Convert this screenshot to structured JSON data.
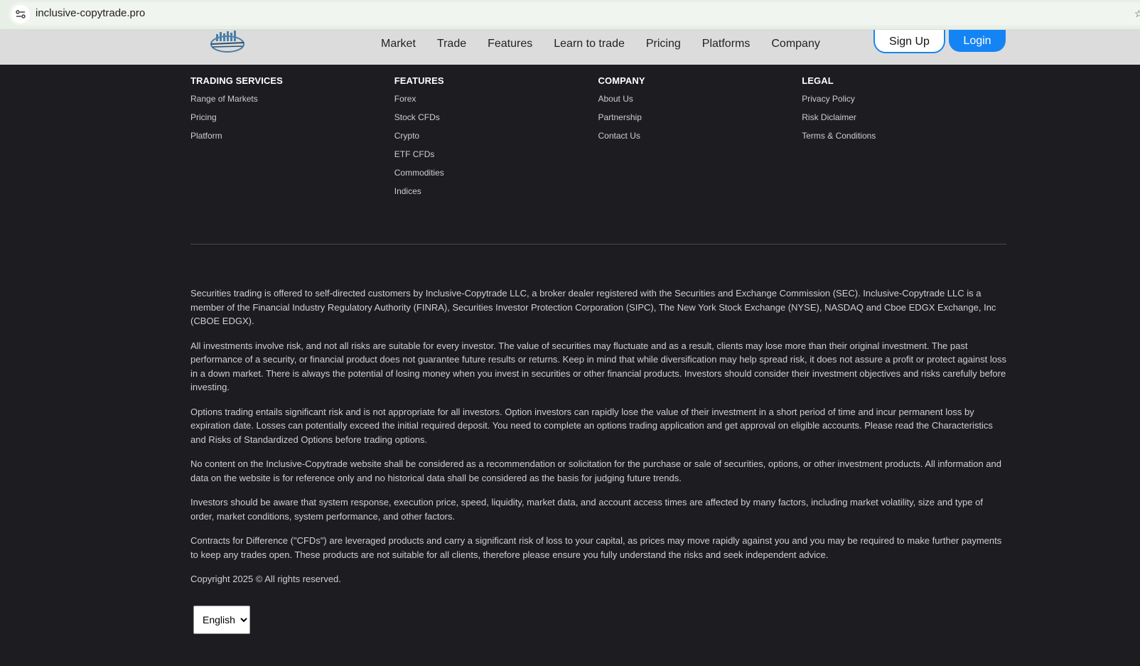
{
  "browser": {
    "url": "inclusive-copytrade.pro"
  },
  "header": {
    "nav": [
      "Market",
      "Trade",
      "Features",
      "Learn to trade",
      "Pricing",
      "Platforms",
      "Company"
    ],
    "signup_label": "Sign Up",
    "login_label": "Login",
    "accent_color": "#1484f5"
  },
  "footer": {
    "columns": [
      {
        "title": "TRADING SERVICES",
        "links": [
          "Range of Markets",
          "Pricing",
          "Platform"
        ]
      },
      {
        "title": "FEATURES",
        "links": [
          "Forex",
          "Stock CFDs",
          "Crypto",
          "ETF CFDs",
          "Commodities",
          "Indices"
        ]
      },
      {
        "title": "COMPANY",
        "links": [
          "About Us",
          "Partnership",
          "Contact Us"
        ]
      },
      {
        "title": "LEGAL",
        "links": [
          "Privacy Policy",
          "Risk Diclaimer",
          "Terms & Conditions"
        ]
      }
    ],
    "disclaimers": [
      "Securities trading is offered to self-directed customers by Inclusive-Copytrade LLC, a broker dealer registered with the Securities and Exchange Commission (SEC). Inclusive-Copytrade LLC is a member of the Financial Industry Regulatory Authority (FINRA), Securities Investor Protection Corporation (SIPC), The New York Stock Exchange (NYSE), NASDAQ and Cboe EDGX Exchange, Inc (CBOE EDGX).",
      "All investments involve risk, and not all risks are suitable for every investor. The value of securities may fluctuate and as a result, clients may lose more than their original investment. The past performance of a security, or financial product does not guarantee future results or returns. Keep in mind that while diversification may help spread risk, it does not assure a profit or protect against loss in a down market. There is always the potential of losing money when you invest in securities or other financial products. Investors should consider their investment objectives and risks carefully before investing.",
      "Options trading entails significant risk and is not appropriate for all investors. Option investors can rapidly lose the value of their investment in a short period of time and incur permanent loss by expiration date. Losses can potentially exceed the initial required deposit. You need to complete an options trading application and get approval on eligible accounts. Please read the Characteristics and Risks of Standardized Options before trading options.",
      "No content on the Inclusive-Copytrade website shall be considered as a recommendation or solicitation for the purchase or sale of securities, options, or other investment products. All information and data on the website is for reference only and no historical data shall be considered as the basis for judging future trends.",
      "Investors should be aware that system response, execution price, speed, liquidity, market data, and account access times are affected by many factors, including market volatility, size and type of order, market conditions, system performance, and other factors.",
      "Contracts for Difference (\"CFDs\") are leveraged products and carry a significant risk of loss to your capital, as prices may move rapidly against you and you may be required to make further payments to keep any trades open. These products are not suitable for all clients, therefore please ensure you fully understand the risks and seek independent advice."
    ],
    "copyright": "Copyright 2025 © All rights reserved.",
    "language": {
      "selected": "English",
      "options": [
        "English"
      ]
    }
  }
}
